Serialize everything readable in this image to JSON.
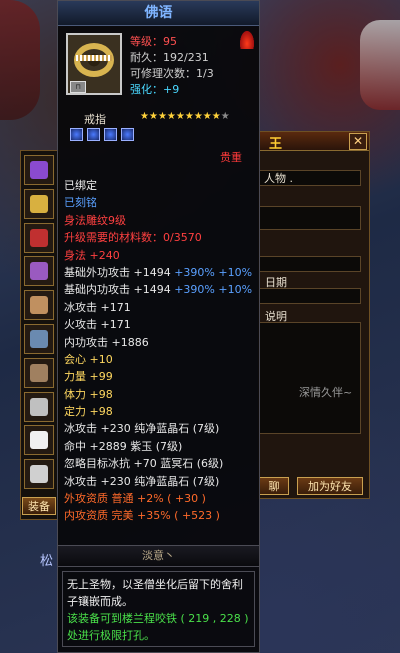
{
  "background": {
    "bottom_label": "松"
  },
  "dialog": {
    "title": "王",
    "field_value": "人物 .",
    "label_date": "日期",
    "label_desc": "说明",
    "faint_text": "深情久伴~",
    "button_left": "聊",
    "button_right": "加为好友",
    "close_icon": "close-icon"
  },
  "inventory": {
    "tab_label": "装备",
    "slot_colors": [
      "#8a4ad0",
      "#d8b040",
      "#c03030",
      "#9a5ac0",
      "#c09060",
      "#6a8ab0",
      "#a08060",
      "#c0c0c0",
      "#f0f0f0",
      "#d0d0d0"
    ]
  },
  "tooltip": {
    "title": "佛语",
    "level": "等级：95",
    "durability": "耐久：192/231",
    "repairable": "可修理次数：1/3",
    "strengthen": "强化：+9",
    "item_type": "戒指",
    "stars_on": 9,
    "stars_total": 10,
    "rarity": "贵重",
    "bound": "已绑定",
    "engraved": "已刻铭",
    "engraving": "身法雕纹9级",
    "upgrade_need": "升级需要的材料数：0/3570",
    "attributes": [
      {
        "text": "身法 +240",
        "color": "#ff4040"
      },
      {
        "text": "基础外功攻击 +1494 +390% +10%",
        "color": "#e8e8e8",
        "color2": "#5aa0ff",
        "split": "+1494"
      },
      {
        "text": "基础内功攻击 +1494 +390% +10%",
        "color": "#e8e8e8",
        "color2": "#5aa0ff",
        "split": "+1494"
      },
      {
        "text": "冰攻击 +171",
        "color": "#e8e8e8"
      },
      {
        "text": "火攻击 +171",
        "color": "#e8e8e8"
      },
      {
        "text": "内功攻击 +1886",
        "color": "#e8e8e8"
      },
      {
        "text": "会心 +10",
        "color": "#ffd860"
      },
      {
        "text": "力量 +99",
        "color": "#ffd860"
      },
      {
        "text": "体力 +98",
        "color": "#ffd860"
      },
      {
        "text": "定力 +98",
        "color": "#ffd860"
      },
      {
        "text": "冰攻击 +230 纯净蓝晶石 (7级)",
        "color": "#e8e8e8"
      },
      {
        "text": "命中 +2889 紫玉 (7级)",
        "color": "#e8e8e8"
      },
      {
        "text": "忽略目标冰抗 +70 蓝冥石 (6级)",
        "color": "#e8e8e8"
      },
      {
        "text": "冰攻击 +230 纯净蓝晶石 (7级)",
        "color": "#e8e8e8"
      },
      {
        "text": "外攻资质  普通  +2% ( +30 )",
        "color": "#ff6a2a"
      },
      {
        "text": "内攻资质  完美  +35% ( +523 )",
        "color": "#ff6a2a"
      }
    ],
    "section_title": "淡意丶",
    "description": "无上圣物，以圣僧坐化后留下的舍利子镶嵌而成。",
    "hint": "该装备可到楼兰程咬铁 ( 219 , 228 ) 处进行极限打孔。"
  },
  "colors": {
    "title_blue": "#7fb4ff",
    "level_red": "#ff5050",
    "strengthen_cyan": "#4ad8ff",
    "bound_white": "#f0f0f0",
    "engraved_blue": "#5aa0ff",
    "engraving_red": "#ff4040",
    "hint_green": "#4ae04a"
  }
}
